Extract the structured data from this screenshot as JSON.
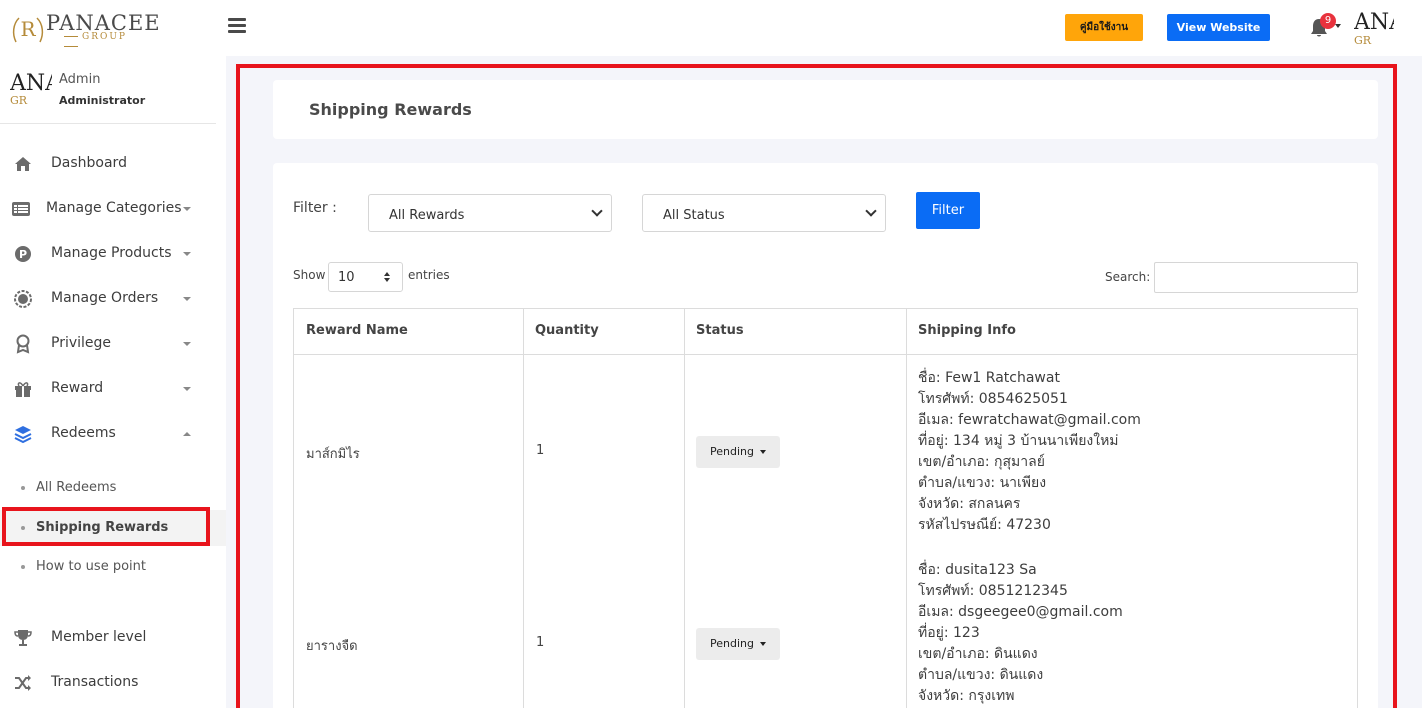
{
  "header": {
    "brand": "PANACEE",
    "brand_group": "GROUP",
    "manual_label": "คู่มือใช้งาน",
    "website_label": "View Website",
    "notification_count": "9",
    "avatar_text": "ANA",
    "avatar_sub": "GR"
  },
  "sidebar": {
    "profile": {
      "avatar_text": "ANA",
      "avatar_sub": "GR",
      "name": "Admin",
      "role": "Administrator"
    },
    "items": [
      {
        "label": "Dashboard",
        "icon": "home-icon"
      },
      {
        "label": "Manage Categories",
        "icon": "list-icon"
      },
      {
        "label": "Manage Products",
        "icon": "product-p-icon"
      },
      {
        "label": "Manage Orders",
        "icon": "gear-badge-icon"
      },
      {
        "label": "Privilege",
        "icon": "award-icon"
      },
      {
        "label": "Reward",
        "icon": "gift-icon"
      },
      {
        "label": "Redeems",
        "icon": "layers-icon"
      }
    ],
    "sub_items": [
      {
        "label": "All Redeems"
      },
      {
        "label": "Shipping Rewards"
      },
      {
        "label": "How to use point"
      }
    ],
    "items_after": [
      {
        "label": "Member level",
        "icon": "trophy-icon"
      },
      {
        "label": "Transactions",
        "icon": "shuffle-icon"
      }
    ]
  },
  "page": {
    "title": "Shipping Rewards",
    "filter_label": "Filter :",
    "reward_select": "All Rewards",
    "status_select": "All Status",
    "filter_button": "Filter",
    "show_label": "Show",
    "entries_value": "10",
    "entries_label": "entries",
    "search_label": "Search:"
  },
  "table": {
    "headers": [
      "Reward Name",
      "Quantity",
      "Status",
      "Shipping Info"
    ],
    "rows": [
      {
        "reward": "มาส์กมิไร",
        "quantity": "1",
        "status": "Pending",
        "info": [
          "ชื่อ: Few1 Ratchawat",
          "โทรศัพท์: 0854625051",
          "อีเมล: fewratchawat@gmail.com",
          "ที่อยู่: 134 หมู่ 3 บ้านนาเพียงใหม่",
          "เขต/อำเภอ: กุสุมาลย์",
          "ตำบล/แขวง: นาเพียง",
          "จังหวัด: สกลนคร",
          "รหัสไปรษณีย์: 47230"
        ]
      },
      {
        "reward": "ยารางจืด",
        "quantity": "1",
        "status": "Pending",
        "info": [
          "ชื่อ: dusita123 Sa",
          "โทรศัพท์: 0851212345",
          "อีเมล: dsgeegee0@gmail.com",
          "ที่อยู่: 123",
          "เขต/อำเภอ: ดินแดง",
          "ตำบล/แขวง: ดินแดง",
          "จังหวัด: กรุงเทพ"
        ]
      }
    ]
  }
}
